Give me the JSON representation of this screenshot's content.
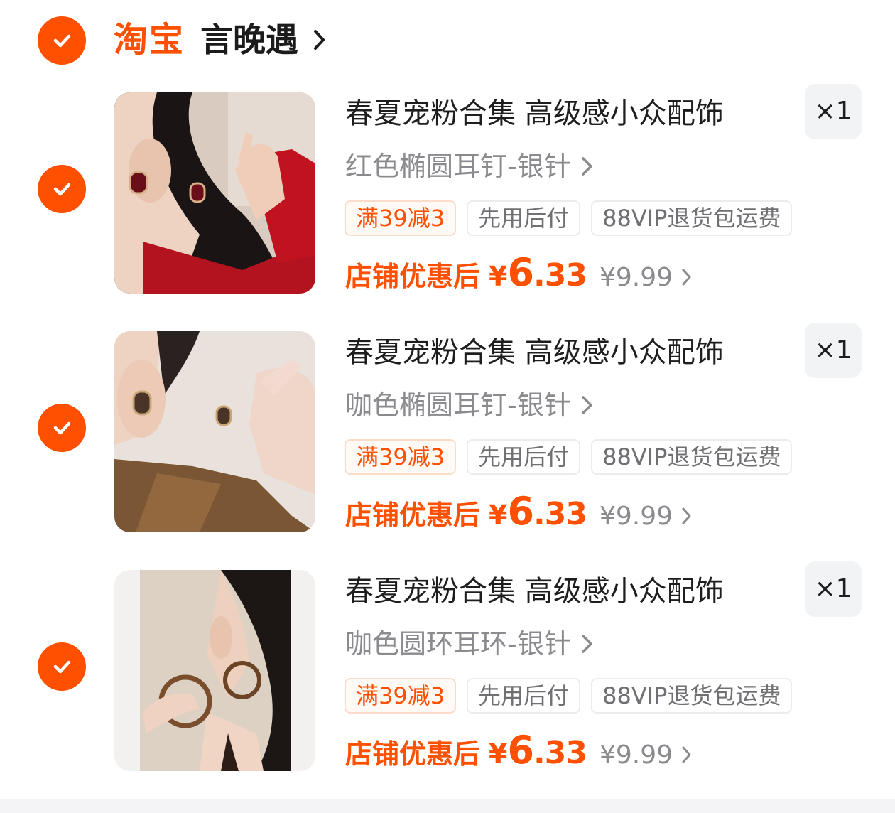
{
  "shop": {
    "platform_logo": "淘宝",
    "name": "言晚遇",
    "checked": true,
    "colors": {
      "accent": "#ff5000"
    }
  },
  "items": [
    {
      "title": "春夏宠粉合集 高级感小众配饰",
      "sku": "红色椭圆耳钉-银针",
      "quantity": "×1",
      "tags": [
        "满39减3",
        "先用后付",
        "88VIP退货包运费"
      ],
      "price_label": "店铺优惠后",
      "price_symbol": "¥",
      "price_integer": "6",
      "price_decimal": ".33",
      "original_price": "¥9.99",
      "image_icon": "red-oval-earring-photo",
      "checked": true
    },
    {
      "title": "春夏宠粉合集 高级感小众配饰",
      "sku": "咖色椭圆耳钉-银针",
      "quantity": "×1",
      "tags": [
        "满39减3",
        "先用后付",
        "88VIP退货包运费"
      ],
      "price_label": "店铺优惠后",
      "price_symbol": "¥",
      "price_integer": "6",
      "price_decimal": ".33",
      "original_price": "¥9.99",
      "image_icon": "brown-oval-earring-photo",
      "checked": true
    },
    {
      "title": "春夏宠粉合集 高级感小众配饰",
      "sku": "咖色圆环耳环-银针",
      "quantity": "×1",
      "tags": [
        "满39减3",
        "先用后付",
        "88VIP退货包运费"
      ],
      "price_label": "店铺优惠后",
      "price_symbol": "¥",
      "price_integer": "6",
      "price_decimal": ".33",
      "original_price": "¥9.99",
      "image_icon": "brown-hoop-earring-photo",
      "checked": true
    }
  ]
}
